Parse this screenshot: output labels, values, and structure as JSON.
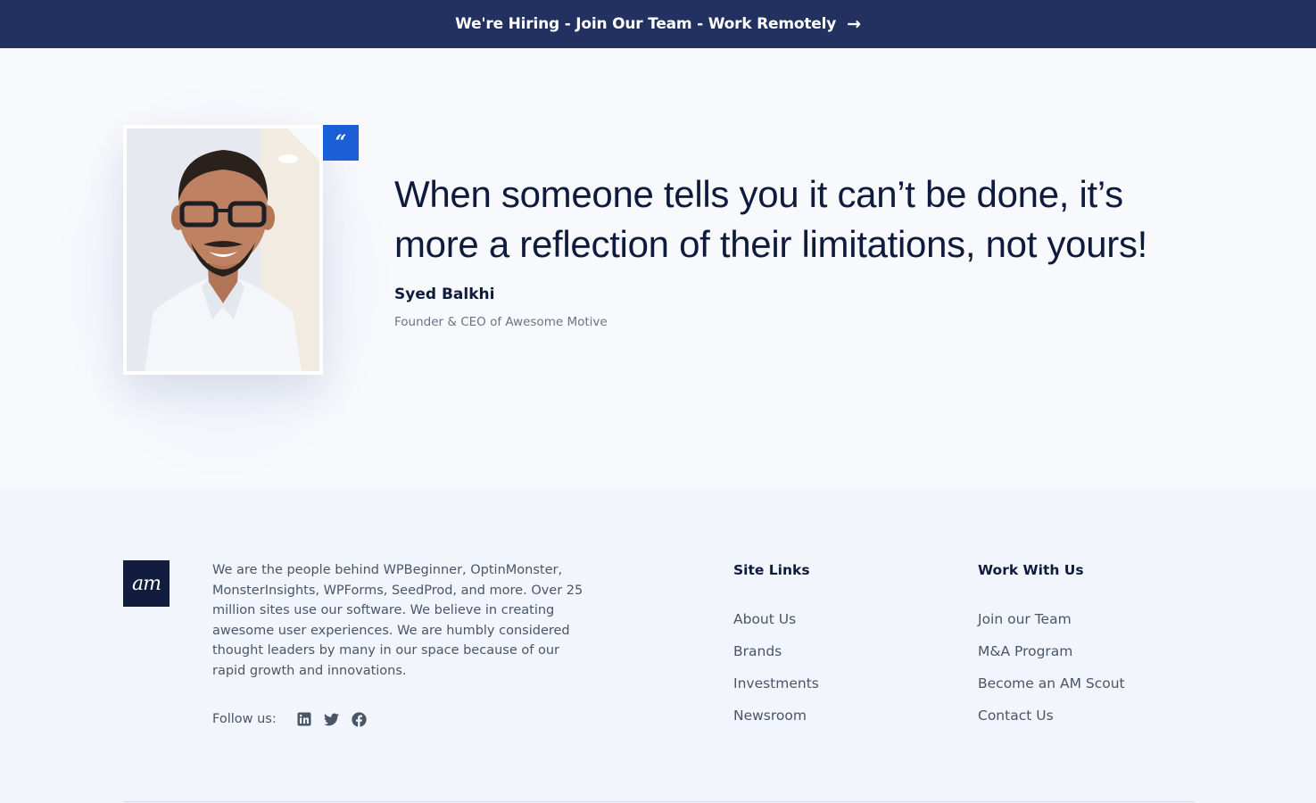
{
  "topbar": {
    "label": "We're Hiring - Join Our Team - Work Remotely",
    "arrow": "→",
    "background": "#233161"
  },
  "quote": {
    "badge": "“",
    "text": "When someone tells you it can’t be done, it’s more a reflection of their limitations, not yours!",
    "author": "Syed Balkhi",
    "author_title": "Founder & CEO of Awesome Motive",
    "accent": "#1a5fd6",
    "photo_alt": "portrait-photo"
  },
  "footer": {
    "logo_text": "am",
    "about": "We are the people behind WPBeginner, OptinMonster, MonsterInsights, WPForms, SeedProd, and more. Over 25 million sites use our software. We believe in creating awesome user experiences. We are humbly considered thought leaders by many in our space because of our rapid growth and innovations.",
    "follow_label": "Follow us:",
    "social": [
      {
        "icon": "linkedin-icon"
      },
      {
        "icon": "twitter-icon"
      },
      {
        "icon": "facebook-icon"
      }
    ],
    "site_links": {
      "heading": "Site Links",
      "items": [
        "About Us",
        "Brands",
        "Investments",
        "Newsroom"
      ]
    },
    "work_with_us": {
      "heading": "Work With Us",
      "items": [
        "Join our Team",
        "M&A Program",
        "Become an AM Scout",
        "Contact Us"
      ]
    }
  }
}
